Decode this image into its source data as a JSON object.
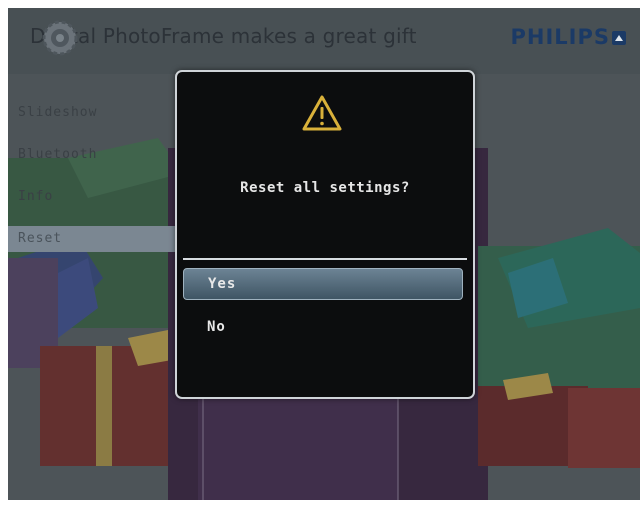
{
  "header": {
    "tagline": "Digital PhotoFrame makes a great gift",
    "brand": "PHILIPS"
  },
  "side_menu": {
    "items": [
      {
        "label": "Slideshow"
      },
      {
        "label": "Bluetooth"
      },
      {
        "label": "Info"
      },
      {
        "label": "Reset"
      }
    ],
    "selected": "Reset"
  },
  "dialog": {
    "icon": "warning-icon",
    "prompt": "Reset all settings?",
    "options": [
      {
        "label": "Yes",
        "selected": true
      },
      {
        "label": "No",
        "selected": false
      }
    ]
  },
  "colors": {
    "accent": "#d9b13a",
    "highlight": "#4f6576",
    "dialog_bg": "#0c0d0e"
  }
}
